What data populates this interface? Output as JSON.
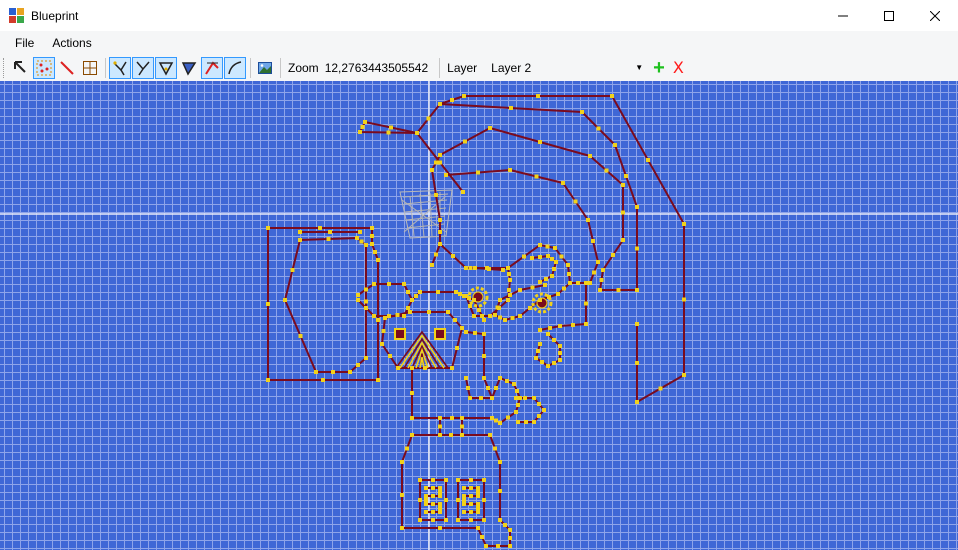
{
  "window": {
    "title": "Blueprint"
  },
  "menu": {
    "items": [
      "File",
      "Actions"
    ]
  },
  "toolbar": {
    "zoom_label": "Zoom",
    "zoom_value": "12,2763443505542",
    "layer_label": "Layer",
    "layer_value": "Layer 2",
    "add_symbol": "+",
    "delete_symbol": "X"
  },
  "colors": {
    "canvas": "#3f67d6",
    "grid": "#8ea4ea",
    "line": "#7a0b1e",
    "vertex": "#f2d21a",
    "add": "#1ec01e",
    "delete": "#ff1a1a"
  }
}
